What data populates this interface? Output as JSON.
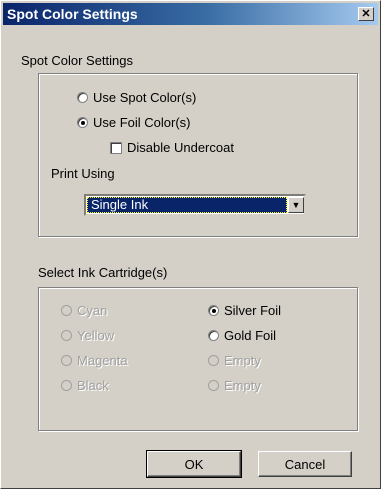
{
  "window": {
    "title": "Spot Color Settings",
    "close_glyph": "✕"
  },
  "spot_group": {
    "heading": "Spot Color Settings",
    "options": [
      {
        "label": "Use Spot Color(s)",
        "checked": false
      },
      {
        "label": "Use Foil Color(s)",
        "checked": true
      }
    ],
    "disable_undercoat": {
      "label": "Disable Undercoat",
      "checked": false
    },
    "print_using_label": "Print Using",
    "print_using_value": "Single Ink",
    "dropdown_icon": "chevron-down-icon"
  },
  "ink_group": {
    "heading": "Select Ink Cartridge(s)",
    "left": [
      {
        "label": "Cyan",
        "checked": false,
        "enabled": false
      },
      {
        "label": "Yellow",
        "checked": false,
        "enabled": false
      },
      {
        "label": "Magenta",
        "checked": false,
        "enabled": false
      },
      {
        "label": "Black",
        "checked": false,
        "enabled": false
      }
    ],
    "right": [
      {
        "label": "Silver Foil",
        "checked": true,
        "enabled": true
      },
      {
        "label": "Gold Foil",
        "checked": false,
        "enabled": true
      },
      {
        "label": "Empty",
        "checked": false,
        "enabled": false
      },
      {
        "label": "Empty",
        "checked": false,
        "enabled": false
      }
    ]
  },
  "buttons": {
    "ok": "OK",
    "cancel": "Cancel"
  }
}
